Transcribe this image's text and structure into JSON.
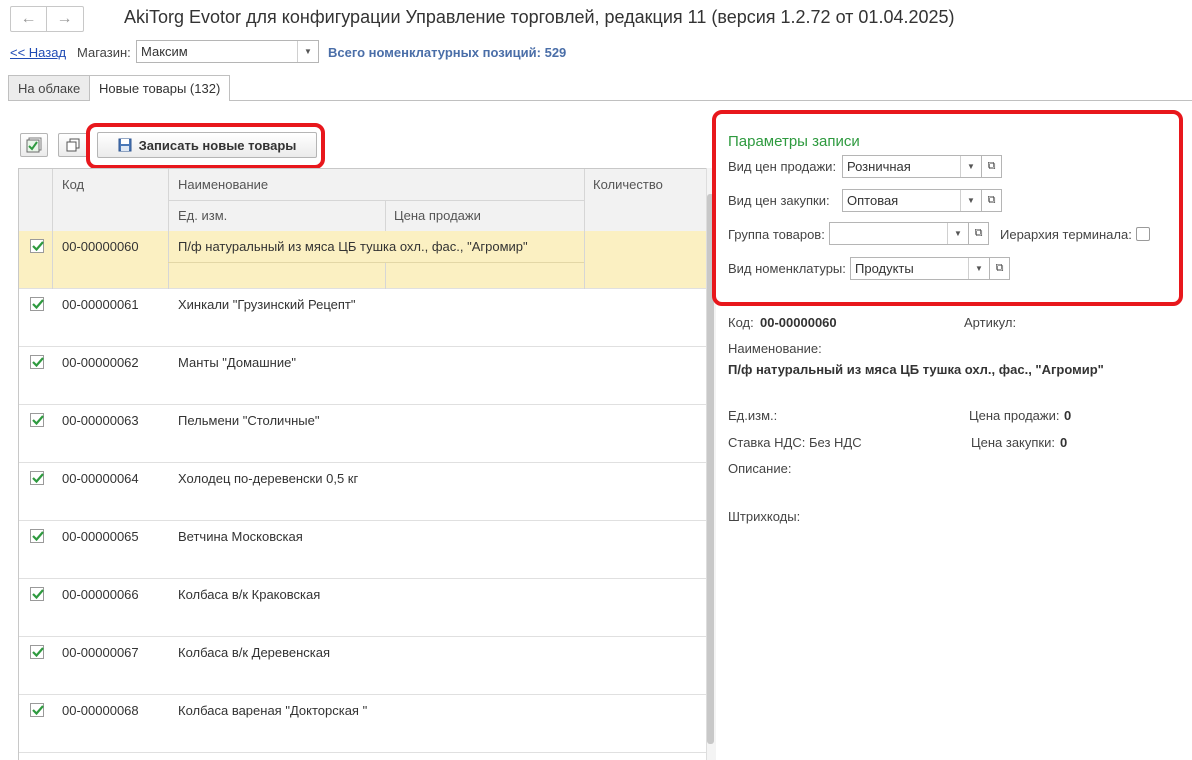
{
  "window": {
    "title": "AkiTorg Evotor для конфигурации Управление торговлей, редакция 11 (версия 1.2.72 от 01.04.2025)",
    "nav_back_icon": "arrow-left-icon",
    "nav_forward_icon": "arrow-right-icon"
  },
  "form": {
    "back_link": "<< Назад",
    "store_label": "Магазин:",
    "store_value": "Максим",
    "total_text": "Всего номенклатурных позиций: 529"
  },
  "tabs": [
    {
      "label": "На облаке",
      "active": false
    },
    {
      "label": "Новые товары (132)",
      "active": true
    }
  ],
  "toolbar": {
    "check_all_icon": "check-all-icon",
    "copy_icon": "copy-icon",
    "save_label": "Записать новые товары",
    "save_icon": "floppy-disk-icon"
  },
  "table": {
    "headers": {
      "code": "Код",
      "name": "Наименование",
      "unit": "Ед. изм.",
      "price": "Цена продажи",
      "quantity": "Количество"
    },
    "rows": [
      {
        "checked": true,
        "code": "00-00000060",
        "name": "П/ф натуральный из мяса ЦБ тушка охл., фас., \"Агромир\"",
        "selected": true
      },
      {
        "checked": true,
        "code": "00-00000061",
        "name": "Хинкали \"Грузинский Рецепт\"",
        "selected": false
      },
      {
        "checked": true,
        "code": "00-00000062",
        "name": "Манты \"Домашние\"",
        "selected": false
      },
      {
        "checked": true,
        "code": "00-00000063",
        "name": "Пельмени \"Столичные\"",
        "selected": false
      },
      {
        "checked": true,
        "code": "00-00000064",
        "name": "Холодец по-деревенски 0,5 кг",
        "selected": false
      },
      {
        "checked": true,
        "code": "00-00000065",
        "name": "Ветчина Московская",
        "selected": false
      },
      {
        "checked": true,
        "code": "00-00000066",
        "name": "Колбаса в/к Краковская",
        "selected": false
      },
      {
        "checked": true,
        "code": "00-00000067",
        "name": "Колбаса в/к Деревенская",
        "selected": false
      },
      {
        "checked": true,
        "code": "00-00000068",
        "name": "Колбаса вареная \"Докторская \"",
        "selected": false
      }
    ]
  },
  "params": {
    "title": "Параметры записи",
    "sale_price_label": "Вид цен продажи:",
    "sale_price_value": "Розничная",
    "purchase_price_label": "Вид цен закупки:",
    "purchase_price_value": "Оптовая",
    "group_label": "Группа товаров:",
    "group_value": "",
    "hierarchy_label": "Иерархия терминала:",
    "hierarchy_checked": false,
    "nomenclature_label": "Вид номенклатуры:",
    "nomenclature_value": "Продукты"
  },
  "details": {
    "code_label": "Код:",
    "code_value": "00-00000060",
    "article_label": "Артикул:",
    "name_label": "Наименование:",
    "name_value": "П/ф натуральный из мяса ЦБ тушка охл., фас., \"Агромир\"",
    "unit_label": "Ед.изм.:",
    "sale_price_label": "Цена продажи:",
    "sale_price_value": "0",
    "vat_label": "Ставка НДС:",
    "vat_value": "Без НДС",
    "purchase_price_label": "Цена закупки:",
    "purchase_price_value": "0",
    "description_label": "Описание:",
    "barcodes_label": "Штрихкоды:"
  },
  "colors": {
    "highlight_border": "#e8171c",
    "selected_row": "#fbf0c2",
    "section_title": "#2e9a3f",
    "link": "#1f4bb5",
    "checkmark": "#2e9a3f"
  }
}
